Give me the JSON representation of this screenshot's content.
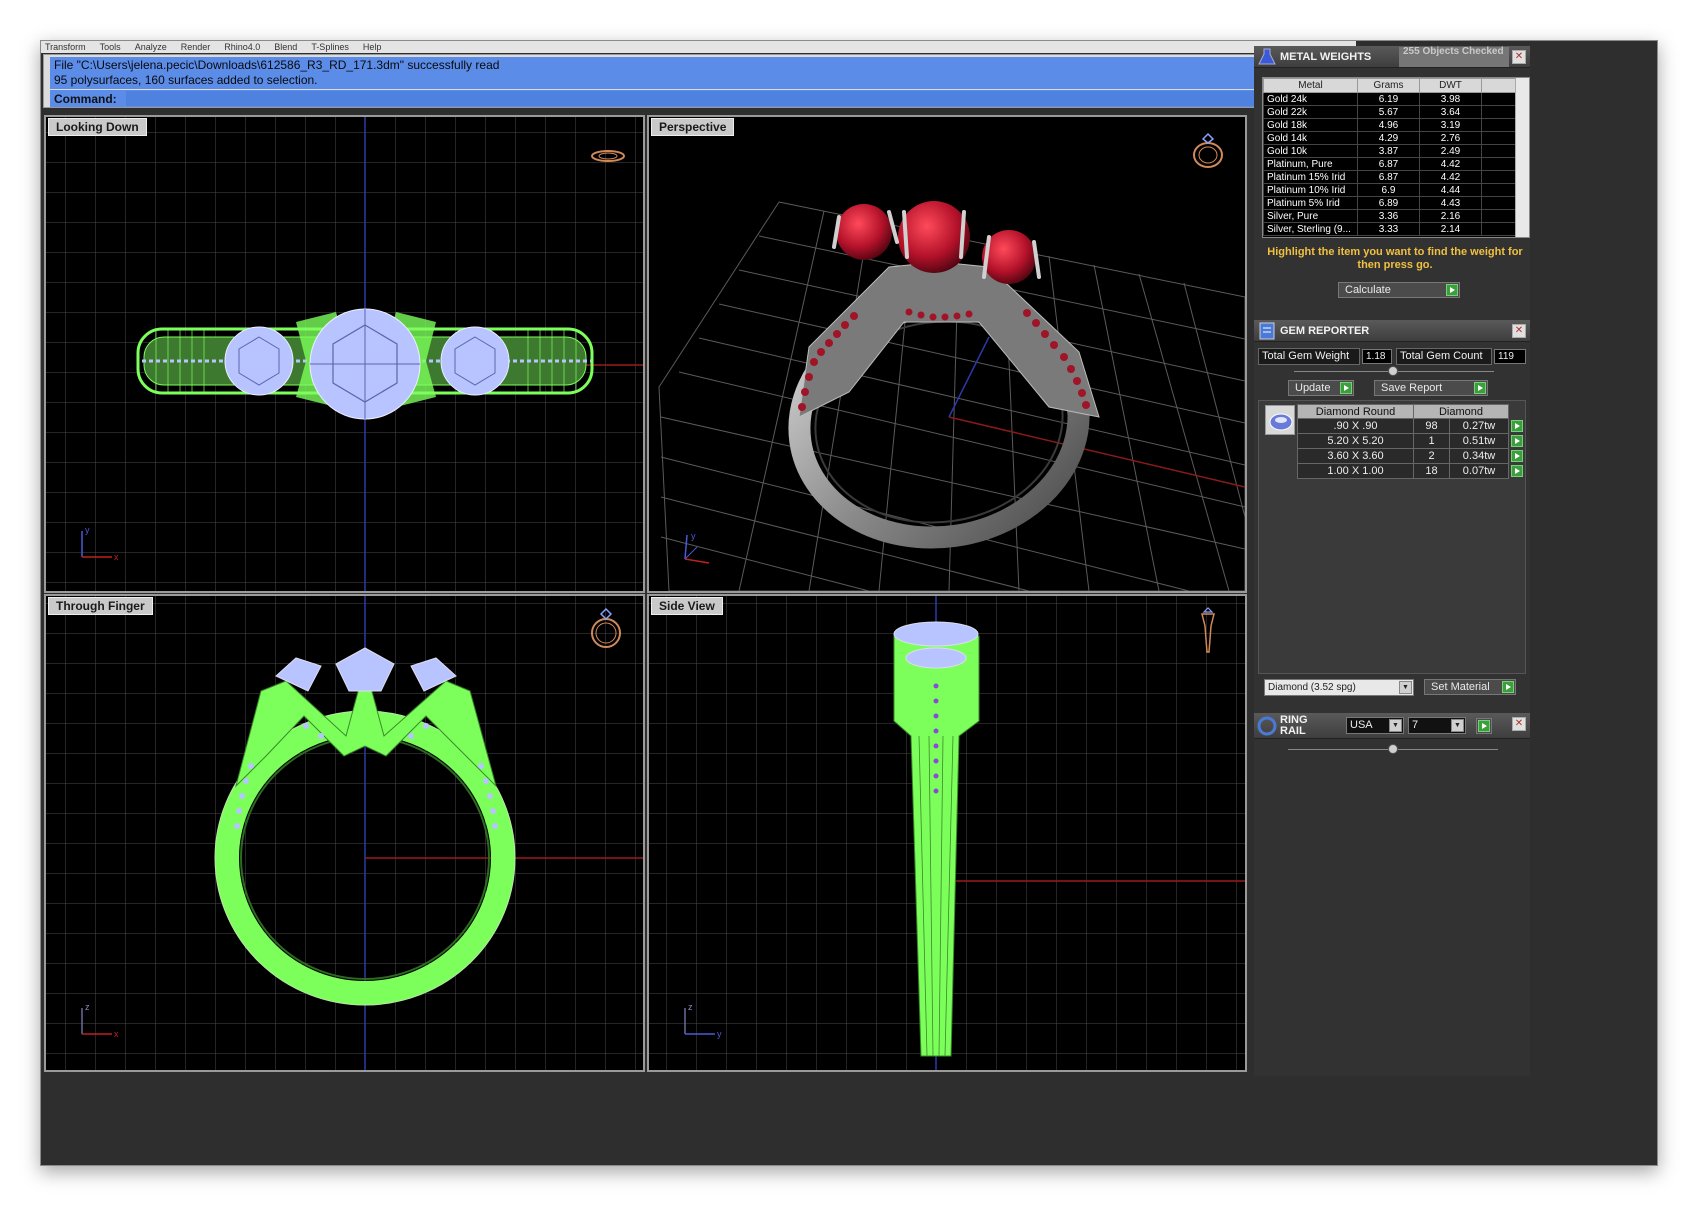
{
  "menu": [
    "Transform",
    "Tools",
    "Analyze",
    "Render",
    "Rhino4.0",
    "Blend",
    "T-Splines",
    "Help"
  ],
  "command": {
    "history": [
      "File \"C:\\Users\\jelena.pecic\\Downloads\\612586_R3_RD_171.3dm\" successfully read",
      "95 polysurfaces, 160 surfaces added to selection."
    ],
    "label": "Command:",
    "value": ""
  },
  "viewports": {
    "top": {
      "title": "Looking Down"
    },
    "perspective": {
      "title": "Perspective"
    },
    "front": {
      "title": "Through Finger"
    },
    "side": {
      "title": "Side View"
    }
  },
  "metal_weights": {
    "title": "METAL WEIGHTS",
    "status": "255 Objects Checked",
    "columns": [
      "Metal",
      "Grams",
      "DWT"
    ],
    "rows": [
      [
        "Gold 24k",
        "6.19",
        "3.98"
      ],
      [
        "Gold 22k",
        "5.67",
        "3.64"
      ],
      [
        "Gold 18k",
        "4.96",
        "3.19"
      ],
      [
        "Gold 14k",
        "4.29",
        "2.76"
      ],
      [
        "Gold 10k",
        "3.87",
        "2.49"
      ],
      [
        "Platinum, Pure",
        "6.87",
        "4.42"
      ],
      [
        "Platinum 15% Irid",
        "6.87",
        "4.42"
      ],
      [
        "Platinum 10% Irid",
        "6.9",
        "4.44"
      ],
      [
        "Platinum 5% Irid",
        "6.89",
        "4.43"
      ],
      [
        "Silver, Pure",
        "3.36",
        "2.16"
      ],
      [
        "Silver, Sterling (9...",
        "3.33",
        "2.14"
      ]
    ],
    "hint": "Highlight the item you want to find the weight for then press go.",
    "calculate_label": "Calculate"
  },
  "gem_reporter": {
    "title": "GEM REPORTER",
    "total_weight_label": "Total Gem Weight",
    "total_weight_value": "1.18",
    "total_count_label": "Total Gem Count",
    "total_count_value": "119",
    "update_label": "Update",
    "save_label": "Save Report",
    "table_headers": [
      "Diamond Round",
      "Diamond"
    ],
    "rows": [
      [
        ".90 X .90",
        "98",
        "0.27tw"
      ],
      [
        "5.20 X 5.20",
        "1",
        "0.51tw"
      ],
      [
        "3.60 X 3.60",
        "2",
        "0.34tw"
      ],
      [
        "1.00 X 1.00",
        "18",
        "0.07tw"
      ]
    ],
    "material_value": "Diamond    (3.52 spg)",
    "set_material_label": "Set Material"
  },
  "ring_rail": {
    "title": "RING RAIL",
    "country": "USA",
    "size": "7"
  },
  "colors": {
    "wireframe": "#7CFF5A",
    "stone_wire": "#b8c4ff",
    "ruby": "#b4122a",
    "metal": "#9a9a9a",
    "accent_command": "#5b8ce8"
  }
}
